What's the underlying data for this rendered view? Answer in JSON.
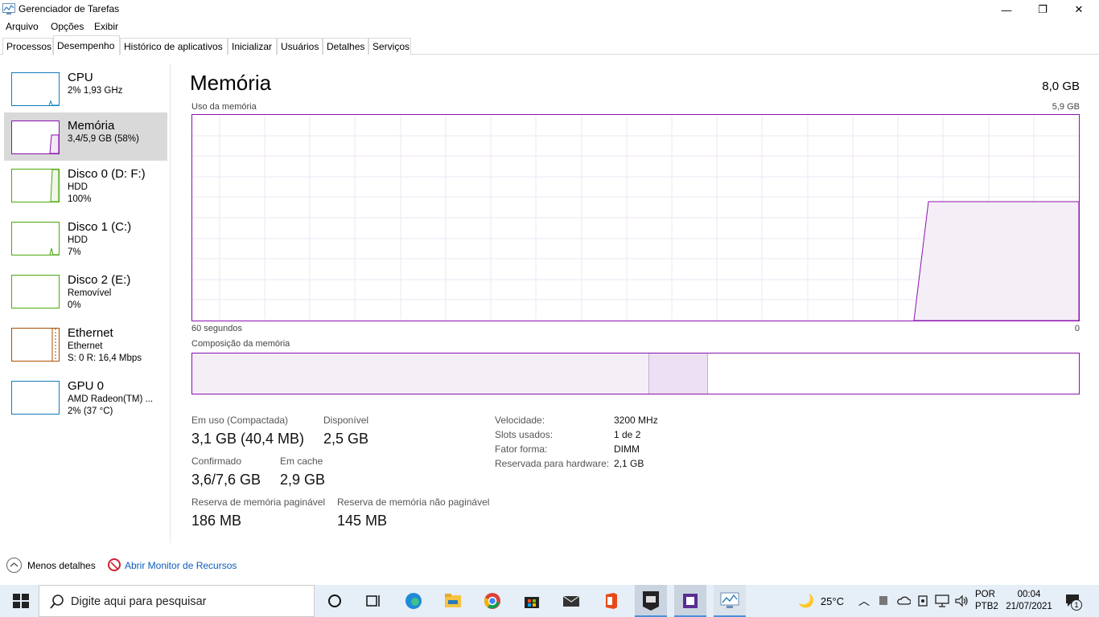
{
  "window": {
    "title": "Gerenciador de Tarefas",
    "minimize": "—",
    "maximize": "❐",
    "close": "✕"
  },
  "menu": [
    "Arquivo",
    "Opções",
    "Exibir"
  ],
  "tabs": [
    {
      "label": "Processos"
    },
    {
      "label": "Desempenho"
    },
    {
      "label": "Histórico de aplicativos"
    },
    {
      "label": "Inicializar"
    },
    {
      "label": "Usuários"
    },
    {
      "label": "Detalhes"
    },
    {
      "label": "Serviços"
    }
  ],
  "sidebar": [
    {
      "name": "CPU",
      "line1": "2%  1,93 GHz",
      "line2": "",
      "color": "#117dbb"
    },
    {
      "name": "Memória",
      "line1": "3,4/5,9 GB (58%)",
      "line2": "",
      "color": "#8b12ae"
    },
    {
      "name": "Disco 0 (D: F:)",
      "line1": "HDD",
      "line2": "100%",
      "color": "#4da60c"
    },
    {
      "name": "Disco 1 (C:)",
      "line1": "HDD",
      "line2": "7%",
      "color": "#4da60c"
    },
    {
      "name": "Disco 2 (E:)",
      "line1": "Removível",
      "line2": "0%",
      "color": "#4da60c"
    },
    {
      "name": "Ethernet",
      "line1": "Ethernet",
      "line2": "S: 0  R: 16,4 Mbps",
      "color": "#a74f01"
    },
    {
      "name": "GPU 0",
      "line1": "AMD Radeon(TM) ...",
      "line2": "2% (37 °C)",
      "color": "#117dbb"
    }
  ],
  "main": {
    "title": "Memória",
    "total": "8,0 GB",
    "usage_label": "Uso da memória",
    "usage_max": "5,9 GB",
    "time_left": "60 segundos",
    "time_right": "0",
    "composition_label": "Composição da memória",
    "usage_percent": 58,
    "composition": {
      "in_use_fraction": 0.515,
      "modified_fraction": 0.066
    }
  },
  "stats": {
    "in_use_label": "Em uso (Compactada)",
    "in_use_value": "3,1 GB (40,4 MB)",
    "available_label": "Disponível",
    "available_value": "2,5 GB",
    "committed_label": "Confirmado",
    "committed_value": "3,6/7,6 GB",
    "cached_label": "Em cache",
    "cached_value": "2,9 GB",
    "paged_label": "Reserva de memória paginável",
    "paged_value": "186 MB",
    "nonpaged_label": "Reserva de memória não paginável",
    "nonpaged_value": "145 MB"
  },
  "props": [
    {
      "label": "Velocidade:",
      "value": "3200 MHz"
    },
    {
      "label": "Slots usados:",
      "value": "1 de 2"
    },
    {
      "label": "Fator forma:",
      "value": "DIMM"
    },
    {
      "label": "Reservada para hardware:",
      "value": "2,1 GB"
    }
  ],
  "footer": {
    "less_details": "Menos detalhes",
    "resource_monitor": "Abrir Monitor de Recursos"
  },
  "taskbar": {
    "search_placeholder": "Digite aqui para pesquisar",
    "temperature": "25°C",
    "lang1": "POR",
    "lang2": "PTB2",
    "time": "00:04",
    "date": "21/07/2021",
    "notifications": "1"
  }
}
